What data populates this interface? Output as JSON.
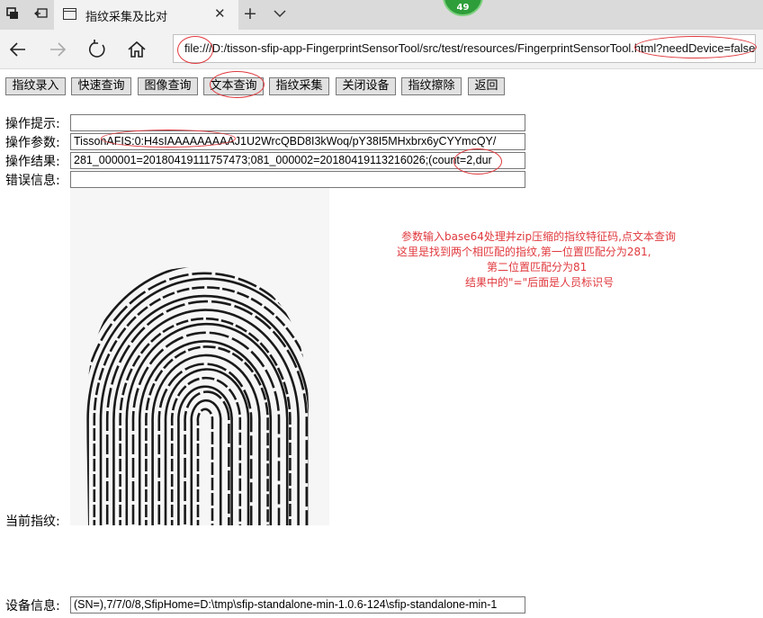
{
  "browser": {
    "tab_title": "指纹采集及比对",
    "badge_count": "49",
    "url": {
      "part1": "file:///D:/tisson-sfip-app-FingerprintSensorTool/src/test/resources/FingerprintSensorTool.",
      "part2": "html?needDevice=false"
    }
  },
  "toolbar": {
    "buttons": [
      "指纹录入",
      "快速查询",
      "图像查询",
      "文本查询",
      "指纹采集",
      "关闭设备",
      "指纹擦除",
      "返回"
    ]
  },
  "form": {
    "hint_label": "操作提示:",
    "hint_value": "",
    "param_label": "操作参数:",
    "param_value": "TissonAFIS:0:H4sIAAAAAAAAAJ1U2WrcQBD8I3kWoq/pY38I5MHxbrx6yCYYmcQY/",
    "result_label": "操作结果:",
    "result_value": "281_000001=20180419111757473;081_000002=20180419113216026;(count=2,dur",
    "error_label": "错误信息:",
    "error_value": "",
    "fingerprint_label": "当前指纹:",
    "device_label": "设备信息:",
    "device_value": "(SN=),7/7/0/8,SfipHome=D:\\tmp\\sfip-standalone-min-1.0.6-124\\sfip-standalone-min-1"
  },
  "annotation": {
    "lines": [
      "参数输入base64处理并zip压缩的指纹特征码,点文本查询",
      "这里是找到两个相匹配的指纹,第一位置匹配分为281,",
      "第二位置匹配分为81",
      "结果中的\"=\"后面是人员标识号"
    ],
    "color": "#e0393e"
  }
}
